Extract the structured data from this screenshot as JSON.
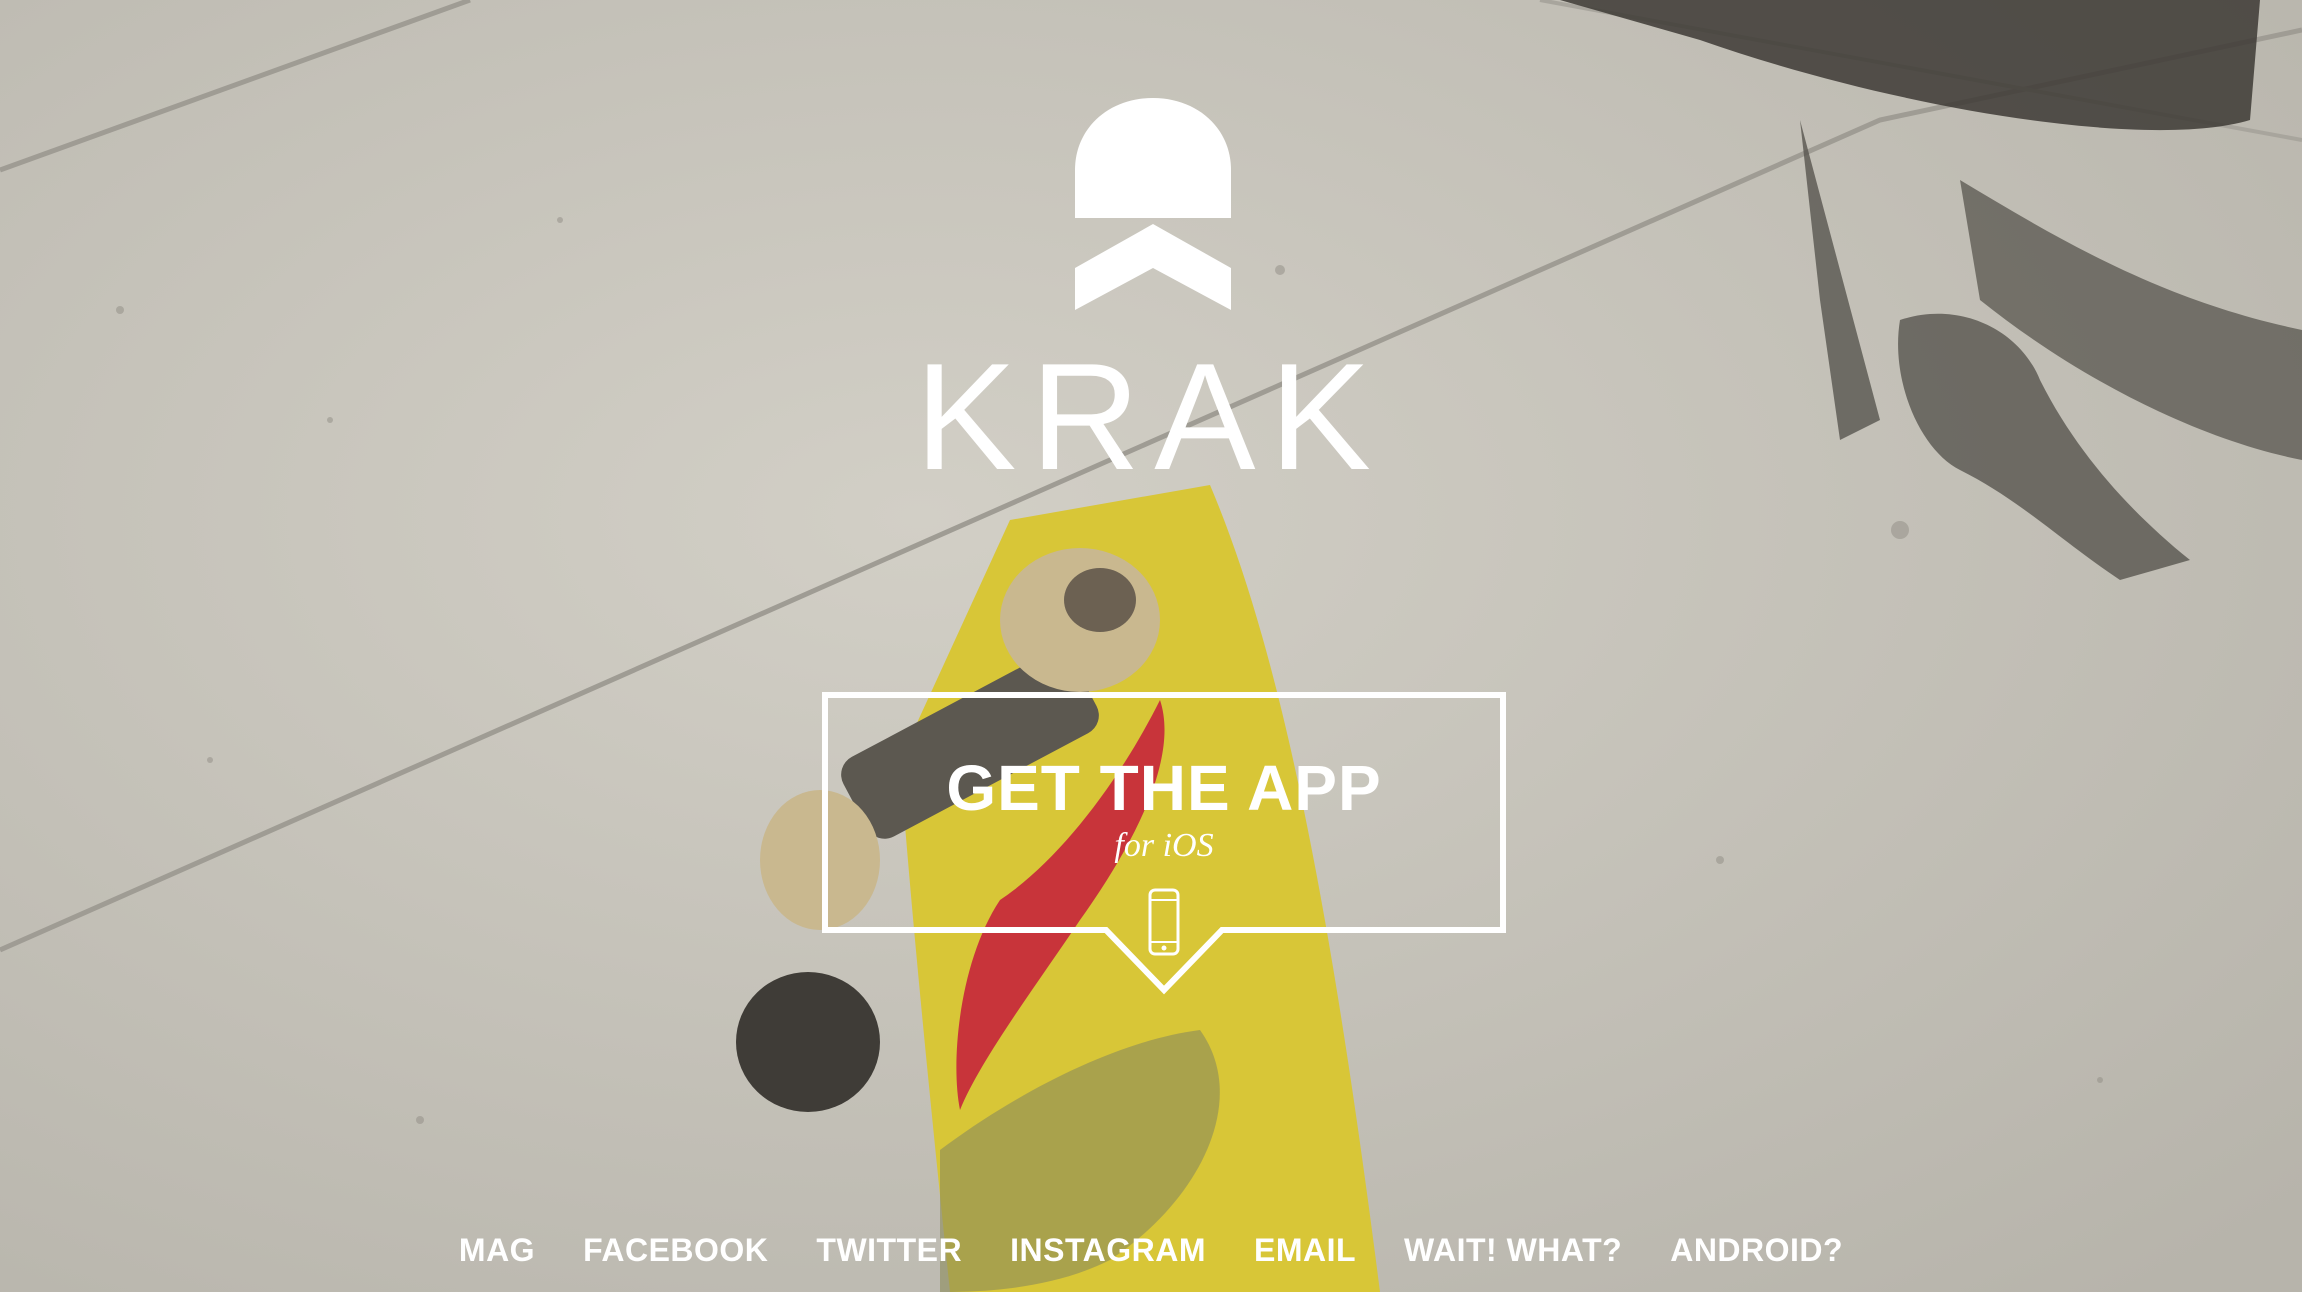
{
  "brand": {
    "name": "KRAK",
    "logo_icon": "krak-helmet-icon"
  },
  "cta": {
    "title": "GET THE APP",
    "subtitle": "for iOS",
    "icon": "phone-icon"
  },
  "footer": {
    "links": [
      {
        "label": "MAG"
      },
      {
        "label": "FACEBOOK"
      },
      {
        "label": "TWITTER"
      },
      {
        "label": "INSTAGRAM"
      },
      {
        "label": "EMAIL"
      },
      {
        "label": "WAIT! WHAT?"
      },
      {
        "label": "ANDROID?"
      }
    ]
  },
  "colors": {
    "text": "#ffffff",
    "pavement": "#c9c6bd",
    "board_yellow": "#d8c637",
    "board_red": "#c8343a"
  }
}
